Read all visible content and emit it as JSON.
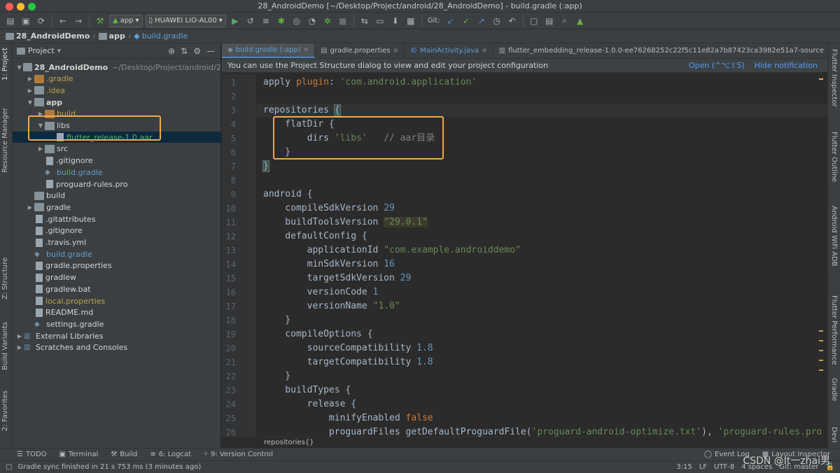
{
  "window": {
    "title": "28_AndroidDemo [~/Desktop/Project/android/28_AndroidDemo] - build.gradle (:app)",
    "traffic": [
      "#ff5f57",
      "#febc2e",
      "#28c840"
    ]
  },
  "toolbar": {
    "run_config": "app",
    "device": "HUAWEI LIO-AL00",
    "git_label": "Git:"
  },
  "breadcrumb": [
    "28_AndroidDemo",
    "app",
    "build.gradle"
  ],
  "left_strip": [
    "1: Project",
    "Resource Manager",
    "Z: Structure",
    "Build Variants",
    "2: Favorites"
  ],
  "right_strip": [
    "Flutter Inspector",
    "Flutter Outline",
    "Android WiFi ADB",
    "Flutter Performance",
    "Gradle",
    "Devi"
  ],
  "project": {
    "header": "Project",
    "tree": [
      {
        "label": "28_AndroidDemo",
        "extra": "~/Desktop/Project/android/2",
        "indent": 0,
        "arrow": "open",
        "icon": "folder",
        "color": "gray",
        "bold": true
      },
      {
        "label": ".gradle",
        "indent": 1,
        "arrow": "closed",
        "icon": "folder-orange",
        "color": "yellow"
      },
      {
        "label": ".idea",
        "indent": 1,
        "arrow": "closed",
        "icon": "folder",
        "color": "yellow"
      },
      {
        "label": "app",
        "indent": 1,
        "arrow": "open",
        "icon": "folder",
        "color": "gray",
        "bold": true
      },
      {
        "label": "build",
        "indent": 2,
        "arrow": "closed",
        "icon": "folder-orange",
        "color": "yellow"
      },
      {
        "label": "libs",
        "indent": 2,
        "arrow": "open",
        "icon": "folder",
        "color": "gray"
      },
      {
        "label": "flutter_release-1.0.aar",
        "indent": 3,
        "arrow": "",
        "icon": "file",
        "color": "green",
        "selected": true
      },
      {
        "label": "src",
        "indent": 2,
        "arrow": "closed",
        "icon": "folder",
        "color": "gray"
      },
      {
        "label": ".gitignore",
        "indent": 2,
        "arrow": "",
        "icon": "file",
        "color": "gray"
      },
      {
        "label": "build.gradle",
        "indent": 2,
        "arrow": "",
        "icon": "gradle",
        "color": "blue"
      },
      {
        "label": "proguard-rules.pro",
        "indent": 2,
        "arrow": "",
        "icon": "file",
        "color": "gray"
      },
      {
        "label": "build",
        "indent": 1,
        "arrow": "",
        "icon": "folder",
        "color": "gray"
      },
      {
        "label": "gradle",
        "indent": 1,
        "arrow": "closed",
        "icon": "folder",
        "color": "gray"
      },
      {
        "label": ".gitattributes",
        "indent": 1,
        "arrow": "",
        "icon": "file",
        "color": "gray"
      },
      {
        "label": ".gitignore",
        "indent": 1,
        "arrow": "",
        "icon": "file",
        "color": "gray"
      },
      {
        "label": ".travis.yml",
        "indent": 1,
        "arrow": "",
        "icon": "file",
        "color": "gray"
      },
      {
        "label": "build.gradle",
        "indent": 1,
        "arrow": "",
        "icon": "gradle",
        "color": "blue"
      },
      {
        "label": "gradle.properties",
        "indent": 1,
        "arrow": "",
        "icon": "file",
        "color": "gray"
      },
      {
        "label": "gradlew",
        "indent": 1,
        "arrow": "",
        "icon": "file",
        "color": "gray"
      },
      {
        "label": "gradlew.bat",
        "indent": 1,
        "arrow": "",
        "icon": "file",
        "color": "gray"
      },
      {
        "label": "local.properties",
        "indent": 1,
        "arrow": "",
        "icon": "file",
        "color": "yellow"
      },
      {
        "label": "README.md",
        "indent": 1,
        "arrow": "",
        "icon": "file",
        "color": "gray"
      },
      {
        "label": "settings.gradle",
        "indent": 1,
        "arrow": "",
        "icon": "gradle",
        "color": "gray"
      },
      {
        "label": "External Libraries",
        "indent": 0,
        "arrow": "closed",
        "icon": "lib",
        "color": "gray"
      },
      {
        "label": "Scratches and Consoles",
        "indent": 0,
        "arrow": "closed",
        "icon": "lib",
        "color": "gray"
      }
    ]
  },
  "tabs": [
    {
      "label": "build.gradle (:app)",
      "active": true
    },
    {
      "label": "gradle.properties"
    },
    {
      "label": "MainActivity.java"
    },
    {
      "label": "flutter_embedding_release-1.0.0-ee76268252c22f5c11e82a7b87423ca3982e51a7-source"
    }
  ],
  "notification": {
    "text": "You can use the Project Structure dialog to view and edit your project configuration",
    "open": "Open (^⌥⇧S)",
    "hide": "Hide notification"
  },
  "code": [
    [
      [
        "plain",
        "apply "
      ],
      [
        "kw",
        "plugin"
      ],
      [
        "plain",
        ": "
      ],
      [
        "str",
        "'com.android.application'"
      ]
    ],
    [],
    [
      [
        "plain",
        "repositories "
      ],
      [
        "br",
        "{"
      ]
    ],
    [
      [
        "plain",
        "    flatDir {"
      ]
    ],
    [
      [
        "plain",
        "        dirs "
      ],
      [
        "str",
        "'libs'"
      ],
      [
        "plain",
        "   "
      ],
      [
        "cmt",
        "// aar目录"
      ]
    ],
    [
      [
        "plain",
        "    }"
      ]
    ],
    [
      [
        "br",
        "}"
      ]
    ],
    [],
    [
      [
        "plain",
        "android {"
      ]
    ],
    [
      [
        "plain",
        "    compileSdkVersion "
      ],
      [
        "num",
        "29"
      ]
    ],
    [
      [
        "plain",
        "    buildToolsVersion "
      ],
      [
        "hls",
        "\"29.0.1\""
      ]
    ],
    [
      [
        "plain",
        "    defaultConfig {"
      ]
    ],
    [
      [
        "plain",
        "        applicationId "
      ],
      [
        "str",
        "\"com.example.androiddemo\""
      ]
    ],
    [
      [
        "plain",
        "        minSdkVersion "
      ],
      [
        "num",
        "16"
      ]
    ],
    [
      [
        "plain",
        "        targetSdkVersion "
      ],
      [
        "num",
        "29"
      ]
    ],
    [
      [
        "plain",
        "        versionCode "
      ],
      [
        "num",
        "1"
      ]
    ],
    [
      [
        "plain",
        "        versionName "
      ],
      [
        "str",
        "\"1.0\""
      ]
    ],
    [
      [
        "plain",
        "    }"
      ]
    ],
    [
      [
        "plain",
        "    compileOptions {"
      ]
    ],
    [
      [
        "plain",
        "        sourceCompatibility "
      ],
      [
        "num",
        "1.8"
      ]
    ],
    [
      [
        "plain",
        "        targetCompatibility "
      ],
      [
        "num",
        "1.8"
      ]
    ],
    [
      [
        "plain",
        "    }"
      ]
    ],
    [
      [
        "plain",
        "    buildTypes {"
      ]
    ],
    [
      [
        "plain",
        "        release {"
      ]
    ],
    [
      [
        "plain",
        "            minifyEnabled "
      ],
      [
        "kw",
        "false"
      ]
    ],
    [
      [
        "plain",
        "            proguardFiles getDefaultProguardFile("
      ],
      [
        "str",
        "'proguard-android-optimize.txt'"
      ],
      [
        "plain",
        "), "
      ],
      [
        "str",
        "'proguard-rules.pro"
      ]
    ]
  ],
  "editor_breadcrumb": "repositories{}",
  "toolwindows": [
    "TODO",
    "Terminal",
    "Build",
    "6: Logcat",
    "9: Version Control"
  ],
  "toolwindows_right": [
    "Event Log",
    "Layout Inspector"
  ],
  "status": {
    "message": "Gradle sync finished in 21 s 753 ms (3 minutes ago)",
    "position": "3:15",
    "line_sep": "LF",
    "encoding": "UTF-8",
    "indent": "4 spaces",
    "vcs": "Git: master"
  },
  "watermark": "CSDN @It一zhai男"
}
